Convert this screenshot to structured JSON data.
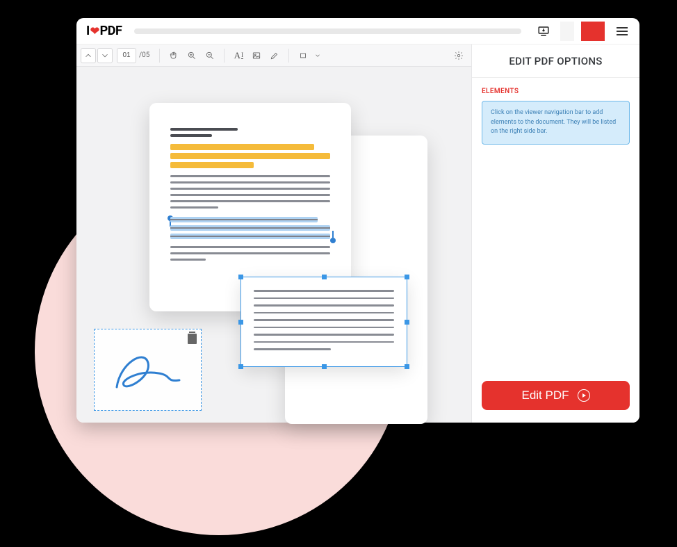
{
  "logo": {
    "i": "I",
    "pdf": "PDF"
  },
  "toolbar": {
    "page_current": "01",
    "page_total": "/05"
  },
  "panel": {
    "title": "EDIT PDF OPTIONS",
    "elements_label": "ELEMENTS",
    "hint": "Click on the viewer navigation bar to add elements to the document. They will be listed on the right side bar."
  },
  "actions": {
    "edit_pdf": "Edit PDF"
  }
}
